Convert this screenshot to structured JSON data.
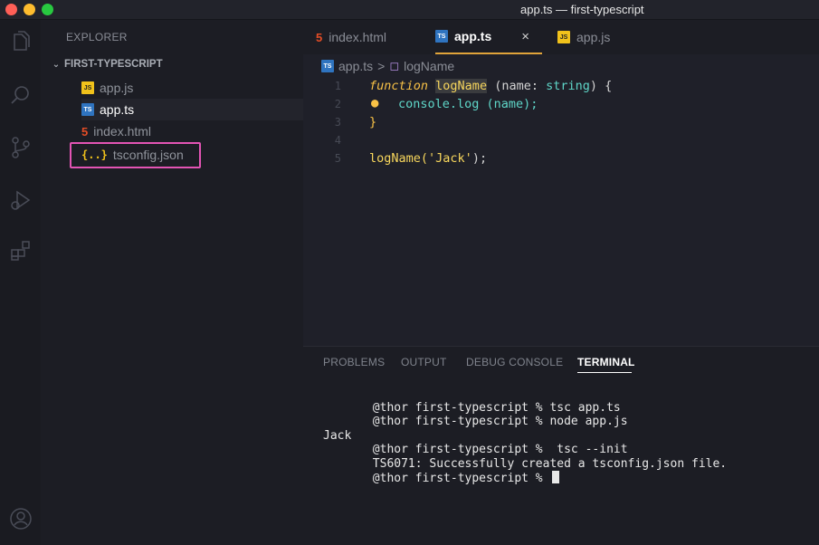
{
  "window": {
    "title": "app.ts — first-typescript"
  },
  "activity_bar": {
    "icons": [
      "files-icon",
      "search-icon",
      "source-control-icon",
      "run-debug-icon",
      "extensions-icon",
      "account-icon"
    ]
  },
  "sidebar": {
    "title": "EXPLORER",
    "folder": "FIRST-TYPESCRIPT",
    "files": [
      {
        "name": "app.js",
        "badge": "JS"
      },
      {
        "name": "app.ts",
        "badge": "TS"
      },
      {
        "name": "index.html",
        "badge": "5"
      },
      {
        "name": "tsconfig.json",
        "badge": "{..}"
      }
    ]
  },
  "editor": {
    "tabs": [
      {
        "label": "index.html",
        "badge": "5"
      },
      {
        "label": "app.ts",
        "badge": "TS",
        "close": "×"
      },
      {
        "label": "app.js",
        "badge": "JS"
      }
    ],
    "breadcrumb": {
      "file": "app.ts",
      "separator": ">",
      "symbol": "logName"
    },
    "lines": [
      {
        "n": "1",
        "tokens": [
          "function",
          " ",
          "logName",
          " (name: ",
          "string",
          ") {"
        ]
      },
      {
        "n": "2",
        "tokens": [
          "console.log (name);"
        ]
      },
      {
        "n": "3",
        "tokens": [
          "}"
        ]
      },
      {
        "n": "4",
        "tokens": [
          ""
        ]
      },
      {
        "n": "5",
        "tokens": [
          "logName(",
          "'Jack'",
          ");"
        ]
      }
    ]
  },
  "panel": {
    "tabs": [
      "PROBLEMS",
      "OUTPUT",
      "DEBUG CONSOLE",
      "TERMINAL"
    ],
    "active_tab": "TERMINAL",
    "terminal_lines": [
      "       @thor first-typescript % tsc app.ts",
      "       @thor first-typescript % node app.js",
      "Jack",
      "       @thor first-typescript %  tsc --init",
      "       TS6071: Successfully created a tsconfig.json file.",
      "       @thor first-typescript % "
    ]
  },
  "colors": {
    "accent_tab_underline": "#e0a43a",
    "highlight_box": "#e354b4",
    "ts_badge": "#2f74c0",
    "js_badge": "#f1c21b",
    "html_icon": "#e44d26"
  }
}
